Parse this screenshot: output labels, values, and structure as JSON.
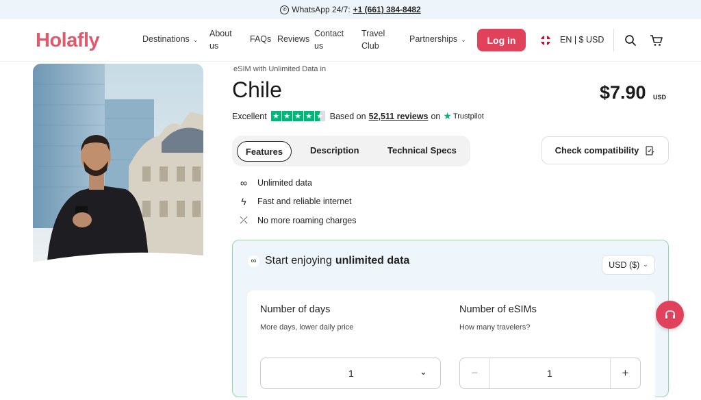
{
  "topbar": {
    "label": "WhatsApp 24/7:",
    "phone": "+1 (661) 384-8482"
  },
  "brand": {
    "logo_text": "Holafly",
    "accent": "#e0425c",
    "logo_color": "#e05a6d"
  },
  "nav": {
    "items": [
      {
        "label": "Destinations",
        "has_dropdown": true
      },
      {
        "label": "About us",
        "has_dropdown": false
      },
      {
        "label": "FAQs",
        "has_dropdown": false
      },
      {
        "label": "Reviews",
        "has_dropdown": false
      },
      {
        "label": "Contact us",
        "has_dropdown": false
      },
      {
        "label": "Travel Club",
        "has_dropdown": false
      },
      {
        "label": "Partnerships",
        "has_dropdown": true
      }
    ],
    "login_label": "Log in",
    "locale_label": "EN | $ USD",
    "icons": [
      "uk-flag-icon",
      "search-icon",
      "cart-icon"
    ]
  },
  "product": {
    "subtitle": "eSIM with Unlimited Data in",
    "country": "Chile",
    "price": "$7.90",
    "currency": "USD",
    "rating_label": "Excellent",
    "rating_stars": 4.5,
    "based_on": "Based on",
    "reviews_count": "52,511 reviews",
    "on_label": "on",
    "trustpilot_label": "Trustpilot"
  },
  "tabs": [
    {
      "label": "Features",
      "active": true
    },
    {
      "label": "Description",
      "active": false
    },
    {
      "label": "Technical Specs",
      "active": false
    }
  ],
  "check_compat_label": "Check compatibility",
  "features": [
    {
      "icon": "infinity-icon",
      "label": "Unlimited data"
    },
    {
      "icon": "bolt-icon",
      "label": "Fast and reliable internet"
    },
    {
      "icon": "no-roaming-icon",
      "label": "No more roaming charges"
    }
  ],
  "plan": {
    "title_prefix": "Start enjoying",
    "title_bold": "unlimited data",
    "currency_select": "USD ($)",
    "days": {
      "title": "Number of days",
      "subtitle": "More days, lower daily price",
      "value": "1"
    },
    "esims": {
      "title": "Number of eSIMs",
      "subtitle": "How many travelers?",
      "value": "1"
    }
  }
}
